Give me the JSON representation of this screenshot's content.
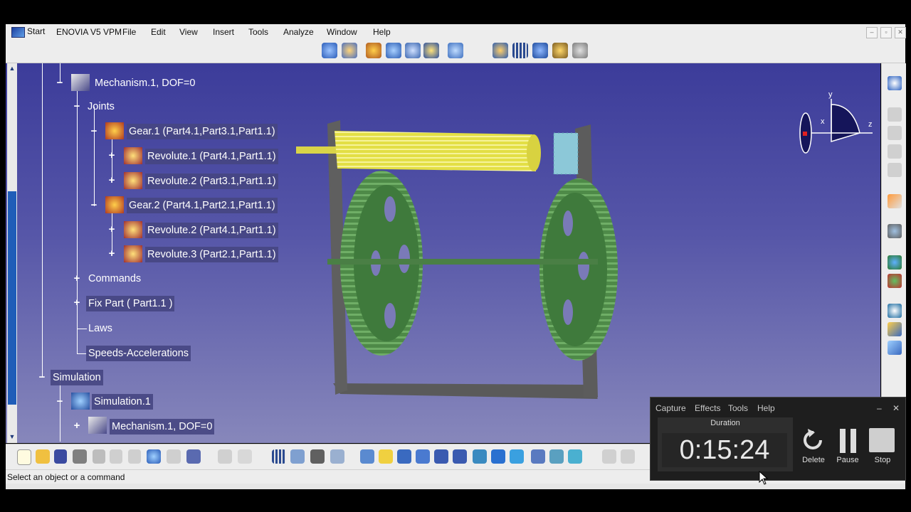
{
  "menubar": {
    "start": "Start",
    "items": [
      "ENOVIA V5 VPM",
      "File",
      "Edit",
      "View",
      "Insert",
      "Tools",
      "Analyze",
      "Window",
      "Help"
    ]
  },
  "window_controls": {
    "minimize": "–",
    "restore": "▫",
    "close": "✕"
  },
  "tree": {
    "mechanism": "Mechanism.1, DOF=0",
    "joints": "Joints",
    "gear1": "Gear.1 (Part4.1,Part3.1,Part1.1)",
    "rev1": "Revolute.1 (Part4.1,Part1.1)",
    "rev2a": "Revolute.2 (Part3.1,Part1.1)",
    "gear2": "Gear.2 (Part4.1,Part2.1,Part1.1)",
    "rev2b": "Revolute.2 (Part4.1,Part1.1)",
    "rev3": "Revolute.3 (Part2.1,Part1.1)",
    "commands": "Commands",
    "fixpart": "Fix Part ( Part1.1 )",
    "laws": "Laws",
    "speeds": "Speeds-Accelerations",
    "simulation": "Simulation",
    "simulation1": "Simulation.1",
    "mechanism2": "Mechanism.1, DOF=0"
  },
  "compass": {
    "x": "x",
    "y": "y",
    "z": "z"
  },
  "status": {
    "text": "Select an object or a command"
  },
  "recorder": {
    "menu": [
      "Capture",
      "Effects",
      "Tools",
      "Help"
    ],
    "duration_label": "Duration",
    "time": "0:15:24",
    "delete": "Delete",
    "pause": "Pause",
    "stop": "Stop",
    "minimize": "–",
    "close": "✕"
  },
  "colors": {
    "viewport_top": "#3c3c9a",
    "viewport_bottom": "#8787bb",
    "gear": "#4f8a4a",
    "shaft": "#e5e24a",
    "accent": "#1f5db8"
  }
}
